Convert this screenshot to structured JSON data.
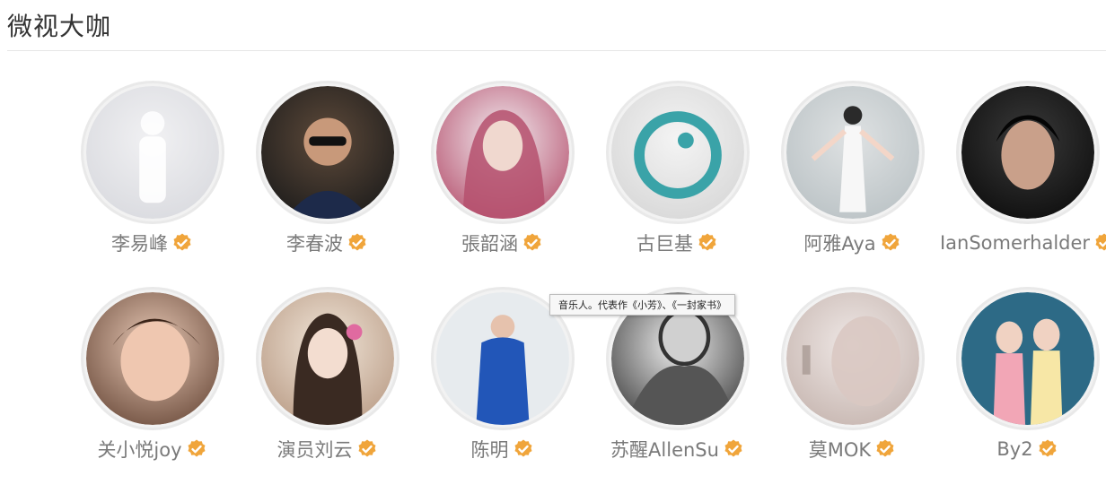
{
  "section": {
    "title": "微视大咖"
  },
  "users": [
    {
      "name": "李易峰",
      "avatar_colors": [
        "#f1f1f3",
        "#d8d9de"
      ]
    },
    {
      "name": "李春波",
      "avatar_colors": [
        "#5e4a3a",
        "#1a1a1a"
      ]
    },
    {
      "name": "張韶涵",
      "avatar_colors": [
        "#f3eef2",
        "#b5506d"
      ]
    },
    {
      "name": "古巨基",
      "avatar_colors": [
        "#f4f4f4",
        "#d6d6d6"
      ]
    },
    {
      "name": "阿雅Aya",
      "avatar_colors": [
        "#dfe2e3",
        "#b9c1c4"
      ]
    },
    {
      "name": "IanSomerhalder",
      "avatar_colors": [
        "#3a3a3a",
        "#0c0c0c"
      ]
    },
    {
      "name": "关小悦joy",
      "avatar_colors": [
        "#e8c9b6",
        "#6a4a3a"
      ]
    },
    {
      "name": "演员刘云",
      "avatar_colors": [
        "#f1e6d9",
        "#b89a84"
      ]
    },
    {
      "name": "陈明",
      "avatar_colors": [
        "#e7ebee",
        "#2256b8"
      ]
    },
    {
      "name": "苏醒AllenSu",
      "avatar_colors": [
        "#efefef",
        "#3e3e3e"
      ]
    },
    {
      "name": "莫MOK",
      "avatar_colors": [
        "#efe8e6",
        "#c5b4ae"
      ]
    },
    {
      "name": "By2",
      "avatar_colors": [
        "#2d6a86",
        "#d9b7a8"
      ]
    }
  ],
  "tooltip": {
    "text": "音乐人。代表作《小芳》、《一封家书》"
  },
  "colors": {
    "verified_badge": "#f0a53b",
    "name_text": "#7a7a7a",
    "ring": "#e9e9e9"
  }
}
